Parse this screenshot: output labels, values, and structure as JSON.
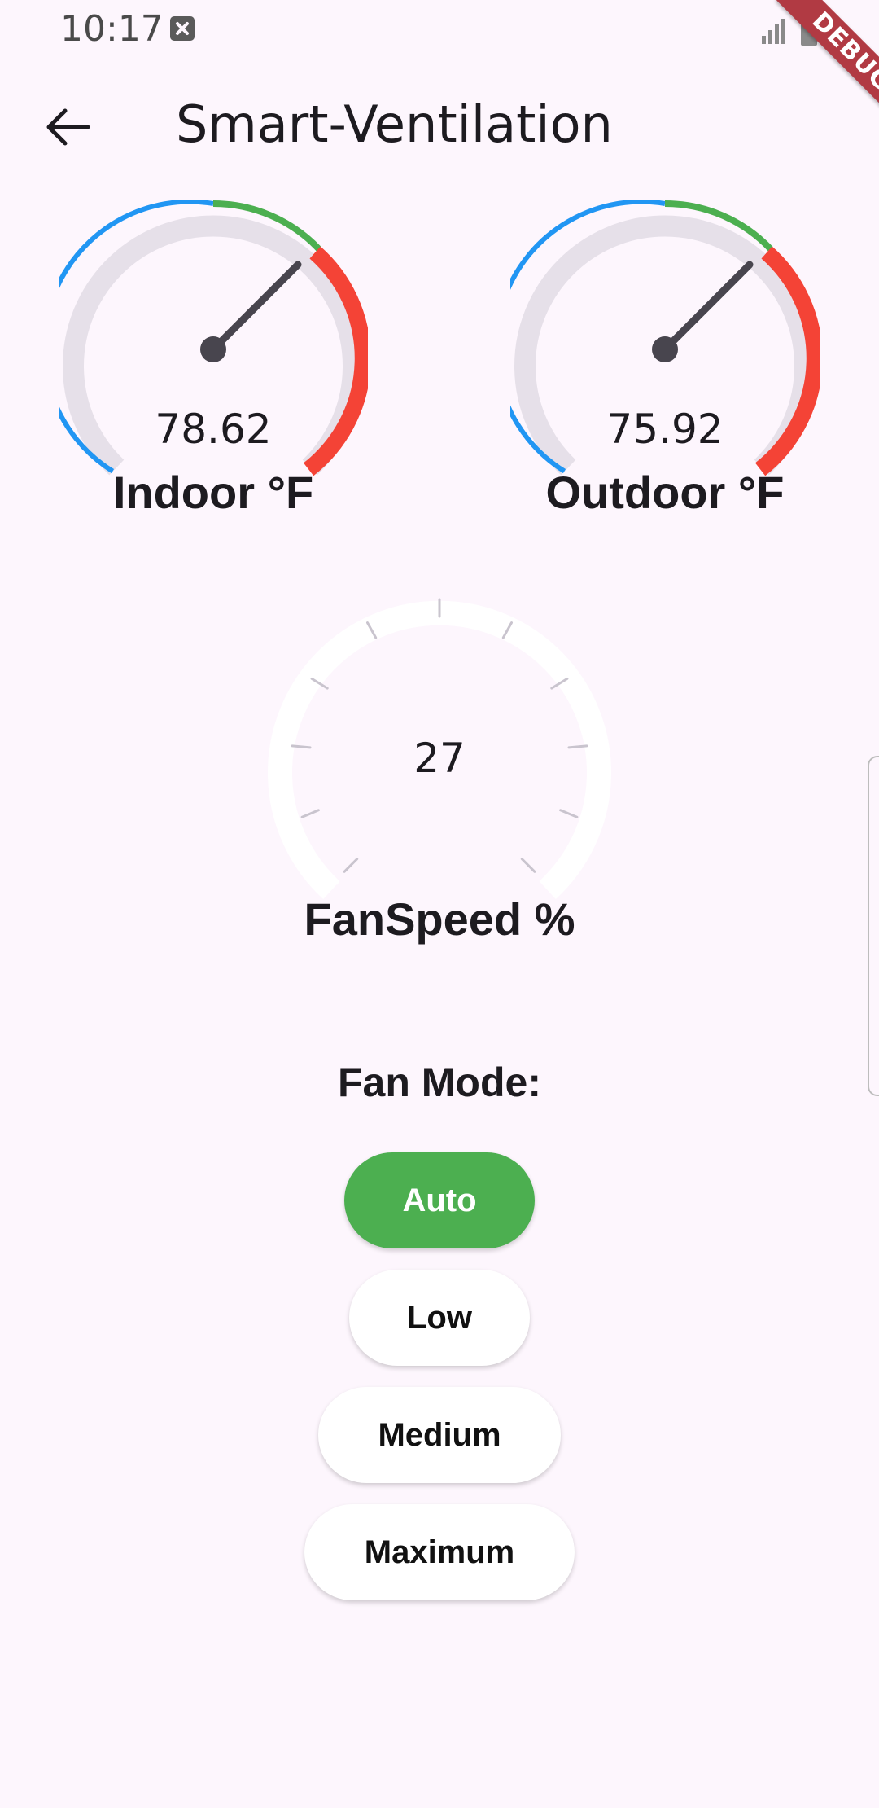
{
  "status_bar": {
    "time": "10:17"
  },
  "debug_label": "DEBUG",
  "app_bar": {
    "title": "Smart-Ventilation"
  },
  "gauges": {
    "indoor": {
      "value": "78.62",
      "label": "Indoor °F"
    },
    "outdoor": {
      "value": "75.92",
      "label": "Outdoor °F"
    },
    "fan_speed": {
      "value": "27",
      "label": "FanSpeed %"
    }
  },
  "fan_mode": {
    "heading": "Fan Mode:",
    "options": [
      "Auto",
      "Low",
      "Medium",
      "Maximum"
    ],
    "selected": "Auto"
  },
  "colors": {
    "background": "#fdf6fd",
    "cold_range": "#2196f3",
    "comfort_range": "#4caf50",
    "hot_range": "#f44336",
    "needle": "#48454e",
    "active_button": "#4caf50"
  },
  "icons": {
    "back": "arrow-back-icon",
    "notification": "close-box-icon",
    "signal": "signal-icon",
    "battery": "battery-icon"
  }
}
